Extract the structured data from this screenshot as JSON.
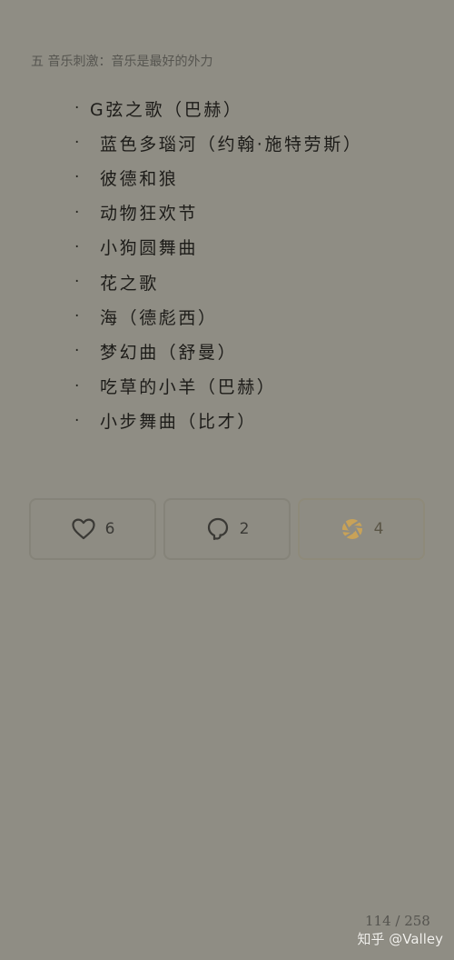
{
  "heading": "五 音乐刺激：音乐是最好的外力",
  "songs": [
    "G弦之歌（巴赫）",
    "蓝色多瑙河（约翰·施特劳斯）",
    "彼德和狼",
    "动物狂欢节",
    "小狗圆舞曲",
    "花之歌",
    "海（德彪西）",
    "梦幻曲（舒曼）",
    "吃草的小羊（巴赫）",
    "小步舞曲（比才）"
  ],
  "bullet_glyph": "·",
  "actions": {
    "like": {
      "icon": "heart-icon",
      "count": "6"
    },
    "comment": {
      "icon": "comment-bubble-icon",
      "count": "2"
    },
    "favorite": {
      "icon": "aperture-icon",
      "count": "4",
      "color": "#c8a258"
    }
  },
  "page_counter": "114 / 258",
  "watermark": "知乎 @Valley"
}
